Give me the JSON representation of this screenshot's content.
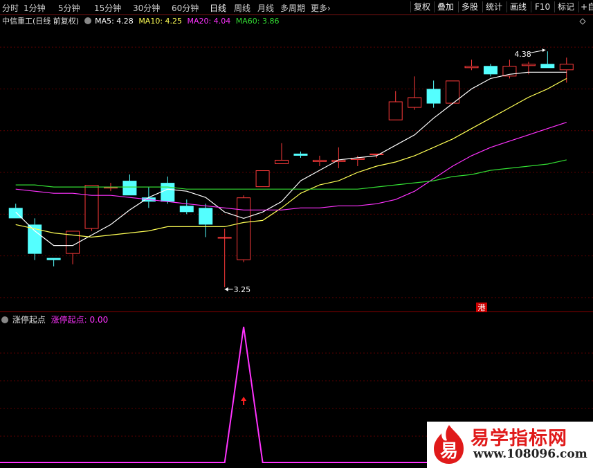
{
  "toolbar": {
    "periods": [
      {
        "label": "分时",
        "active": false
      },
      {
        "label": "1分钟",
        "active": false
      },
      {
        "label": "5分钟",
        "active": false
      },
      {
        "label": "15分钟",
        "active": false
      },
      {
        "label": "30分钟",
        "active": false
      },
      {
        "label": "60分钟",
        "active": false
      },
      {
        "label": "日线",
        "active": true
      },
      {
        "label": "周线",
        "active": false
      },
      {
        "label": "月线",
        "active": false
      },
      {
        "label": "多周期",
        "active": false
      },
      {
        "label": "更多",
        "active": false
      }
    ],
    "more_chevron": "›",
    "buttons": [
      "复权",
      "叠加",
      "多股",
      "统计",
      "画线",
      "F10",
      "标记",
      "+自"
    ]
  },
  "main_legend": {
    "title": "中信重工(日线 前复权)",
    "ma5": "MA5: 4.28",
    "ma10": "MA10: 4.25",
    "ma20": "MA20: 4.04",
    "ma60": "MA60: 3.86"
  },
  "sub_legend": {
    "title": "涨停起点",
    "value": "涨停起点: 0.00"
  },
  "colors": {
    "up": "#ff3b3b",
    "down": "#54ffff",
    "ma5": "#ffffff",
    "ma10": "#ffff55",
    "ma20": "#ff33ff",
    "ma60": "#33dd33",
    "grid": "#5a0000",
    "indicator": "#ff33ff"
  },
  "chart_data": {
    "type": "candlestick",
    "price_range": [
      3.15,
      4.5
    ],
    "price_ticks": [
      4.4,
      4.2,
      4.0,
      3.8,
      3.6,
      3.4,
      3.2
    ],
    "candles": [
      {
        "o": 3.63,
        "h": 3.65,
        "l": 3.58,
        "c": 3.58
      },
      {
        "o": 3.55,
        "h": 3.58,
        "l": 3.38,
        "c": 3.41
      },
      {
        "o": 3.39,
        "h": 3.39,
        "l": 3.35,
        "c": 3.38
      },
      {
        "o": 3.41,
        "h": 3.51,
        "l": 3.36,
        "c": 3.52
      },
      {
        "o": 3.53,
        "h": 3.74,
        "l": 3.52,
        "c": 3.74
      },
      {
        "o": 3.73,
        "h": 3.75,
        "l": 3.71,
        "c": 3.73
      },
      {
        "o": 3.76,
        "h": 3.79,
        "l": 3.69,
        "c": 3.69
      },
      {
        "o": 3.68,
        "h": 3.73,
        "l": 3.63,
        "c": 3.66
      },
      {
        "o": 3.75,
        "h": 3.78,
        "l": 3.65,
        "c": 3.66
      },
      {
        "o": 3.64,
        "h": 3.67,
        "l": 3.6,
        "c": 3.61
      },
      {
        "o": 3.63,
        "h": 3.65,
        "l": 3.49,
        "c": 3.55
      },
      {
        "o": 3.49,
        "h": 3.53,
        "l": 3.25,
        "c": 3.49
      },
      {
        "o": 3.38,
        "h": 3.69,
        "l": 3.37,
        "c": 3.68
      },
      {
        "o": 3.73,
        "h": 3.81,
        "l": 3.73,
        "c": 3.81
      },
      {
        "o": 3.84,
        "h": 3.94,
        "l": 3.84,
        "c": 3.86
      },
      {
        "o": 3.89,
        "h": 3.9,
        "l": 3.87,
        "c": 3.88
      },
      {
        "o": 3.85,
        "h": 3.88,
        "l": 3.83,
        "c": 3.86
      },
      {
        "o": 3.85,
        "h": 3.92,
        "l": 3.82,
        "c": 3.86
      },
      {
        "o": 3.86,
        "h": 3.88,
        "l": 3.83,
        "c": 3.87
      },
      {
        "o": 3.89,
        "h": 3.89,
        "l": 3.87,
        "c": 3.89
      },
      {
        "o": 4.05,
        "h": 4.19,
        "l": 4.05,
        "c": 4.14
      },
      {
        "o": 4.11,
        "h": 4.26,
        "l": 4.1,
        "c": 4.16
      },
      {
        "o": 4.2,
        "h": 4.24,
        "l": 4.11,
        "c": 4.13
      },
      {
        "o": 4.13,
        "h": 4.24,
        "l": 4.13,
        "c": 4.24
      },
      {
        "o": 4.3,
        "h": 4.34,
        "l": 4.29,
        "c": 4.31
      },
      {
        "o": 4.31,
        "h": 4.32,
        "l": 4.26,
        "c": 4.27
      },
      {
        "o": 4.26,
        "h": 4.34,
        "l": 4.25,
        "c": 4.31
      },
      {
        "o": 4.31,
        "h": 4.33,
        "l": 4.27,
        "c": 4.32
      },
      {
        "o": 4.32,
        "h": 4.38,
        "l": 4.3,
        "c": 4.3
      },
      {
        "o": 4.29,
        "h": 4.35,
        "l": 4.23,
        "c": 4.32
      }
    ],
    "ma_series": [
      {
        "name": "MA5",
        "values": [
          3.61,
          3.52,
          3.45,
          3.45,
          3.5,
          3.55,
          3.62,
          3.68,
          3.72,
          3.71,
          3.68,
          3.61,
          3.58,
          3.61,
          3.66,
          3.76,
          3.81,
          3.86,
          3.87,
          3.88,
          3.93,
          3.98,
          4.06,
          4.13,
          4.2,
          4.25,
          4.27,
          4.28,
          4.28,
          4.28
        ]
      },
      {
        "name": "MA10",
        "values": [
          3.55,
          3.53,
          3.51,
          3.5,
          3.49,
          3.5,
          3.51,
          3.52,
          3.54,
          3.54,
          3.54,
          3.54,
          3.56,
          3.57,
          3.63,
          3.7,
          3.74,
          3.76,
          3.8,
          3.83,
          3.85,
          3.88,
          3.92,
          3.96,
          4.01,
          4.06,
          4.11,
          4.16,
          4.2,
          4.25
        ]
      },
      {
        "name": "MA20",
        "values": [
          3.72,
          3.71,
          3.7,
          3.7,
          3.69,
          3.69,
          3.68,
          3.67,
          3.66,
          3.65,
          3.64,
          3.63,
          3.62,
          3.62,
          3.62,
          3.63,
          3.63,
          3.64,
          3.64,
          3.65,
          3.67,
          3.71,
          3.77,
          3.83,
          3.88,
          3.92,
          3.95,
          3.98,
          4.01,
          4.04
        ]
      },
      {
        "name": "MA60",
        "values": [
          3.74,
          3.74,
          3.73,
          3.73,
          3.73,
          3.73,
          3.73,
          3.73,
          3.73,
          3.72,
          3.72,
          3.72,
          3.72,
          3.72,
          3.72,
          3.72,
          3.72,
          3.72,
          3.72,
          3.73,
          3.74,
          3.75,
          3.76,
          3.78,
          3.79,
          3.81,
          3.82,
          3.83,
          3.84,
          3.86
        ]
      }
    ],
    "annotations": {
      "high_label": "4.38",
      "low_label": "3.25",
      "hk_badge": "港"
    },
    "indicator": {
      "name": "涨停起点",
      "values": [
        0,
        0,
        0,
        0,
        0,
        0,
        0,
        0,
        0,
        0,
        0,
        0,
        1,
        0,
        0,
        0,
        0,
        0,
        0,
        0,
        0,
        0,
        0,
        0,
        0,
        0,
        0,
        0,
        0,
        0
      ],
      "signal_index": 12
    }
  },
  "watermark": {
    "char": "易",
    "name": "易学指标网",
    "url": "www.108096.com"
  }
}
